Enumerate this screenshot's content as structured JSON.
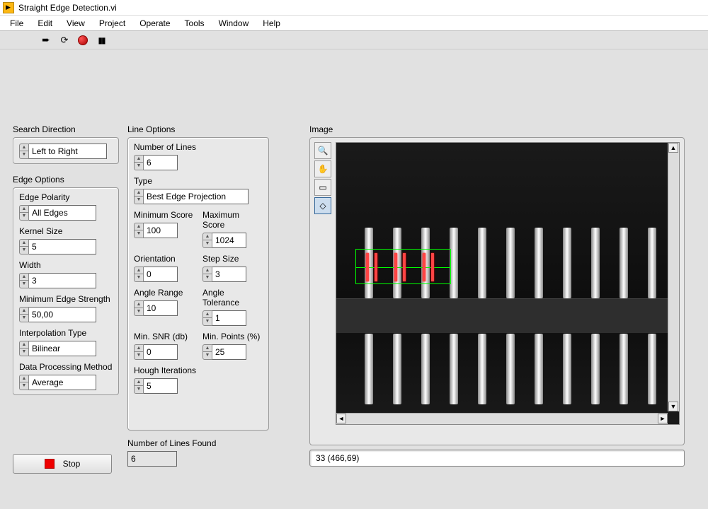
{
  "title": "Straight Edge Detection.vi",
  "menu": [
    "File",
    "Edit",
    "View",
    "Project",
    "Operate",
    "Tools",
    "Window",
    "Help"
  ],
  "search_direction": {
    "label": "Search Direction",
    "value": "Left to Right"
  },
  "edge_options": {
    "title": "Edge Options",
    "polarity": {
      "label": "Edge Polarity",
      "value": "All Edges"
    },
    "kernel": {
      "label": "Kernel Size",
      "value": "5"
    },
    "width": {
      "label": "Width",
      "value": "3"
    },
    "min_strength": {
      "label": "Minimum Edge Strength",
      "value": "50,00"
    },
    "interp": {
      "label": "Interpolation Type",
      "value": "Bilinear"
    },
    "data_proc": {
      "label": "Data Processing Method",
      "value": "Average"
    }
  },
  "line_options": {
    "title": "Line Options",
    "num_lines": {
      "label": "Number of Lines",
      "value": "6"
    },
    "type": {
      "label": "Type",
      "value": "Best Edge Projection"
    },
    "min_score": {
      "label": "Minimum Score",
      "value": "100"
    },
    "max_score": {
      "label": "Maximum Score",
      "value": "1024"
    },
    "orientation": {
      "label": "Orientation",
      "value": "0"
    },
    "step": {
      "label": "Step Size",
      "value": "3"
    },
    "angle_range": {
      "label": "Angle Range",
      "value": "10"
    },
    "angle_tol": {
      "label": "Angle Tolerance",
      "value": "1"
    },
    "min_snr": {
      "label": "Min. SNR (db)",
      "value": "0"
    },
    "min_points": {
      "label": "Min. Points (%)",
      "value": "25"
    },
    "hough": {
      "label": "Hough Iterations",
      "value": "5"
    }
  },
  "lines_found": {
    "label": "Number of Lines Found",
    "value": "6"
  },
  "stop": "Stop",
  "image": {
    "label": "Image",
    "status": "33   (466,69)"
  }
}
